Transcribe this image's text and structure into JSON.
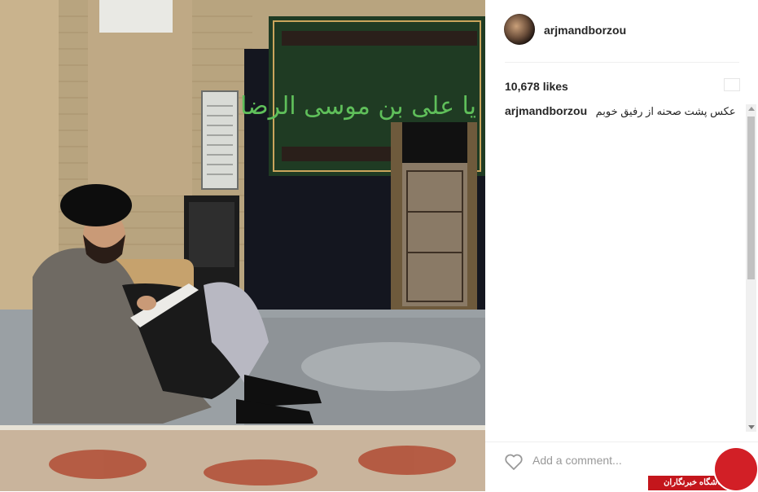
{
  "post": {
    "username": "arjmandborzou",
    "likes": "10,678 likes",
    "caption": {
      "user": "arjmandborzou",
      "text": "عکس پشت صحنه از رفیق خوبم"
    },
    "comment_placeholder": "Add a comment..."
  },
  "photo": {
    "banner_text": "یا علی بن موسی الرضا"
  },
  "watermark": {
    "text": "باشگاه خبرنگاران"
  },
  "icons": {
    "heart": "heart-icon",
    "bookmark": "bookmark-icon",
    "avatar": "avatar",
    "logo": "watermark-logo"
  },
  "colors": {
    "text": "#262626",
    "muted": "#999999",
    "divider": "#efefef",
    "watermark_red": "#c4161c",
    "banner_green": "#1f3b23"
  }
}
